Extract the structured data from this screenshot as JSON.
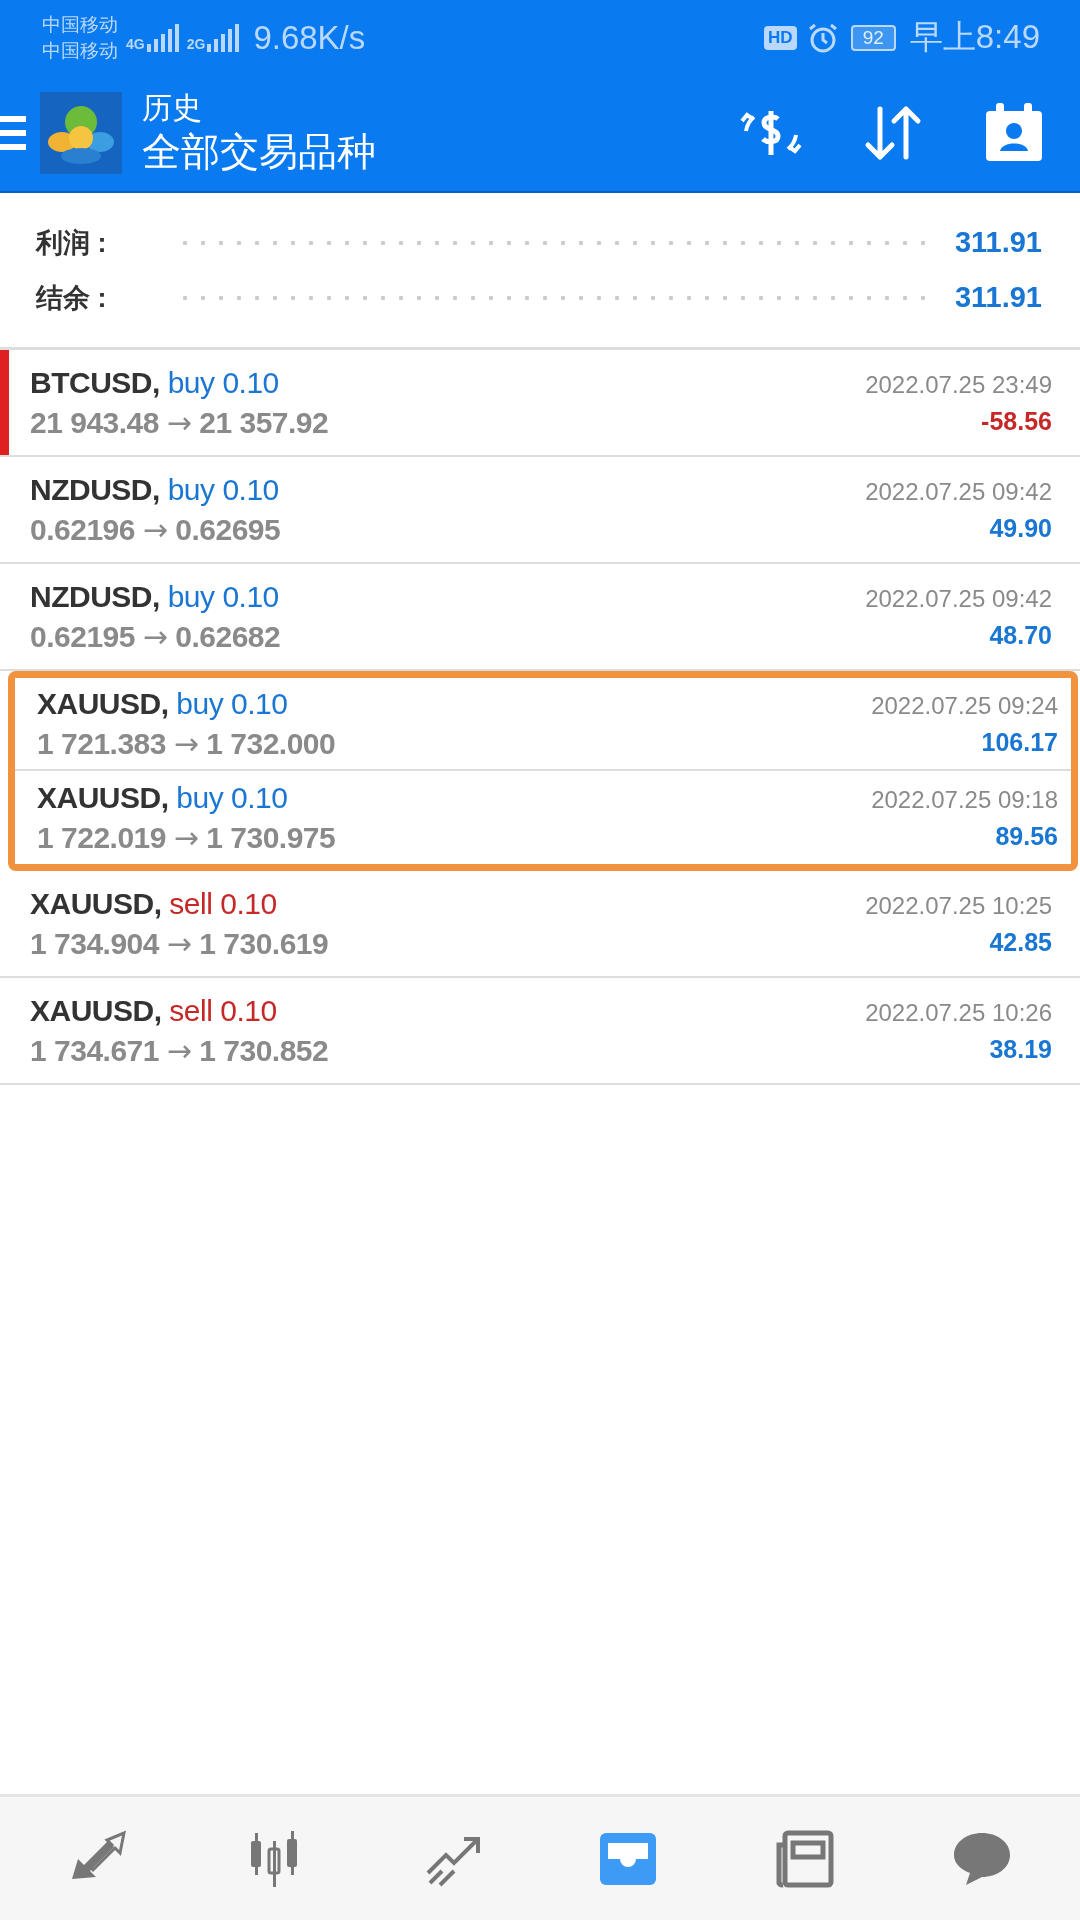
{
  "status_bar": {
    "carriers": [
      "中国移动",
      "中国移动"
    ],
    "network_1": "4G",
    "network_2": "2G",
    "speed": "9.68K/s",
    "hd": "HD",
    "battery": "92",
    "time": "早上8:49"
  },
  "app_bar": {
    "title": "历史",
    "subtitle": "全部交易品种"
  },
  "summary": [
    {
      "label": "利润 :",
      "value": "311.91"
    },
    {
      "label": "结余 :",
      "value": "311.91"
    }
  ],
  "trades": [
    {
      "symbol": "BTCUSD,",
      "side": "buy",
      "volume": "0.10",
      "open": "21 943.48",
      "arrow": "→",
      "close": "21 357.92",
      "time": "2022.07.25 23:49",
      "profit": "-58.56",
      "loss": true,
      "marked": true,
      "highlighted": false
    },
    {
      "symbol": "NZDUSD,",
      "side": "buy",
      "volume": "0.10",
      "open": "0.62196",
      "arrow": "→",
      "close": "0.62695",
      "time": "2022.07.25 09:42",
      "profit": "49.90",
      "loss": false,
      "marked": false,
      "highlighted": false
    },
    {
      "symbol": "NZDUSD,",
      "side": "buy",
      "volume": "0.10",
      "open": "0.62195",
      "arrow": "→",
      "close": "0.62682",
      "time": "2022.07.25 09:42",
      "profit": "48.70",
      "loss": false,
      "marked": false,
      "highlighted": false
    },
    {
      "symbol": "XAUUSD,",
      "side": "buy",
      "volume": "0.10",
      "open": "1 721.383",
      "arrow": "→",
      "close": "1 732.000",
      "time": "2022.07.25 09:24",
      "profit": "106.17",
      "loss": false,
      "marked": false,
      "highlighted": true
    },
    {
      "symbol": "XAUUSD,",
      "side": "buy",
      "volume": "0.10",
      "open": "1 722.019",
      "arrow": "→",
      "close": "1 730.975",
      "time": "2022.07.25 09:18",
      "profit": "89.56",
      "loss": false,
      "marked": false,
      "highlighted": true
    },
    {
      "symbol": "XAUUSD,",
      "side": "sell",
      "volume": "0.10",
      "open": "1 734.904",
      "arrow": "→",
      "close": "1 730.619",
      "time": "2022.07.25 10:25",
      "profit": "42.85",
      "loss": false,
      "marked": false,
      "highlighted": false
    },
    {
      "symbol": "XAUUSD,",
      "side": "sell",
      "volume": "0.10",
      "open": "1 734.671",
      "arrow": "→",
      "close": "1 730.852",
      "time": "2022.07.25 10:26",
      "profit": "38.19",
      "loss": false,
      "marked": false,
      "highlighted": false
    }
  ],
  "bottom_nav": [
    {
      "kind": "quotes",
      "selected": false
    },
    {
      "kind": "chart",
      "selected": false
    },
    {
      "kind": "trade",
      "selected": false
    },
    {
      "kind": "history",
      "selected": true
    },
    {
      "kind": "news",
      "selected": false
    },
    {
      "kind": "chat",
      "selected": false
    }
  ]
}
